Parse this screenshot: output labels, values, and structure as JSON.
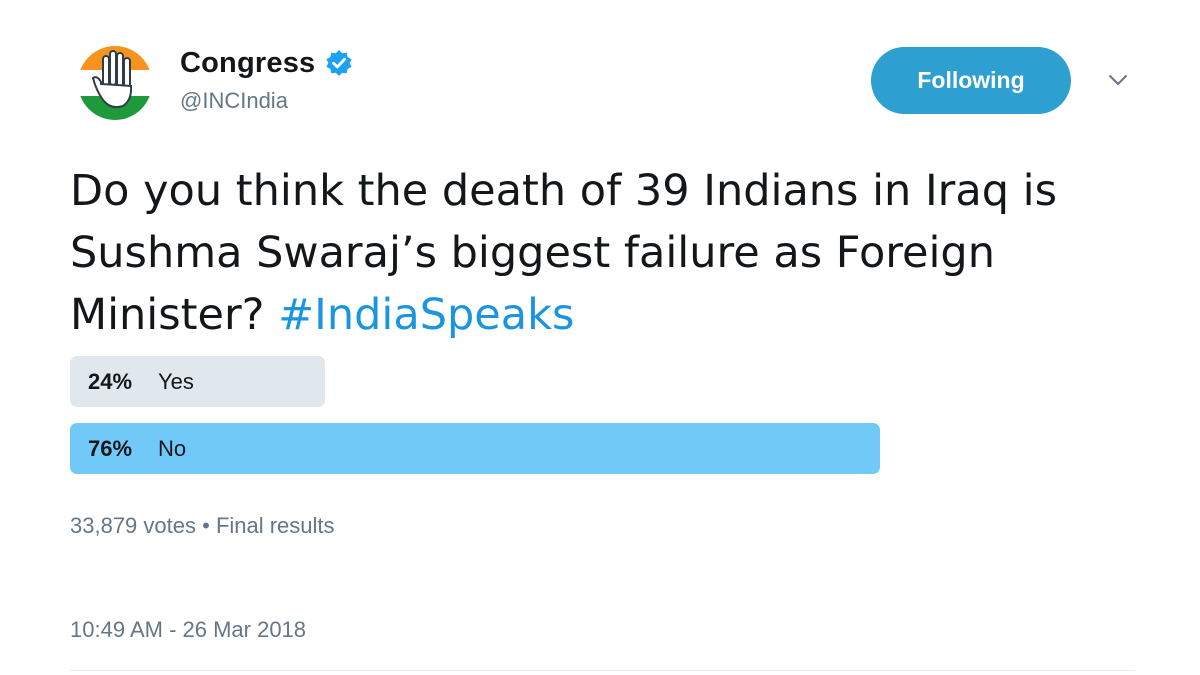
{
  "author": {
    "display_name": "Congress",
    "handle": "@INCIndia",
    "verified": true,
    "avatar_icon": "congress-hand-logo",
    "avatar_colors": {
      "saffron": "#f7931e",
      "white": "#ffffff",
      "green": "#1e9a3c"
    }
  },
  "follow_button": {
    "label": "Following",
    "color": "#2e9fd1"
  },
  "menu": {
    "icon": "chevron-down-icon"
  },
  "tweet": {
    "text": "Do you think the death of 39 Indians in Iraq is Sushma Swaraj’s biggest failure as Foreign Minister? ",
    "hashtag": "#IndiaSpeaks",
    "hashtag_color": "#1b95e0"
  },
  "poll": {
    "options": [
      {
        "percent_text": "24%",
        "label": "Yes",
        "percent": 24,
        "color": "#e1e8ed"
      },
      {
        "percent_text": "76%",
        "label": "No",
        "percent": 76,
        "color": "#71c9f8"
      }
    ],
    "votes": "33,879 votes",
    "separator": "•",
    "status": "Final results"
  },
  "timestamp": "10:49 AM - 26 Mar 2018"
}
